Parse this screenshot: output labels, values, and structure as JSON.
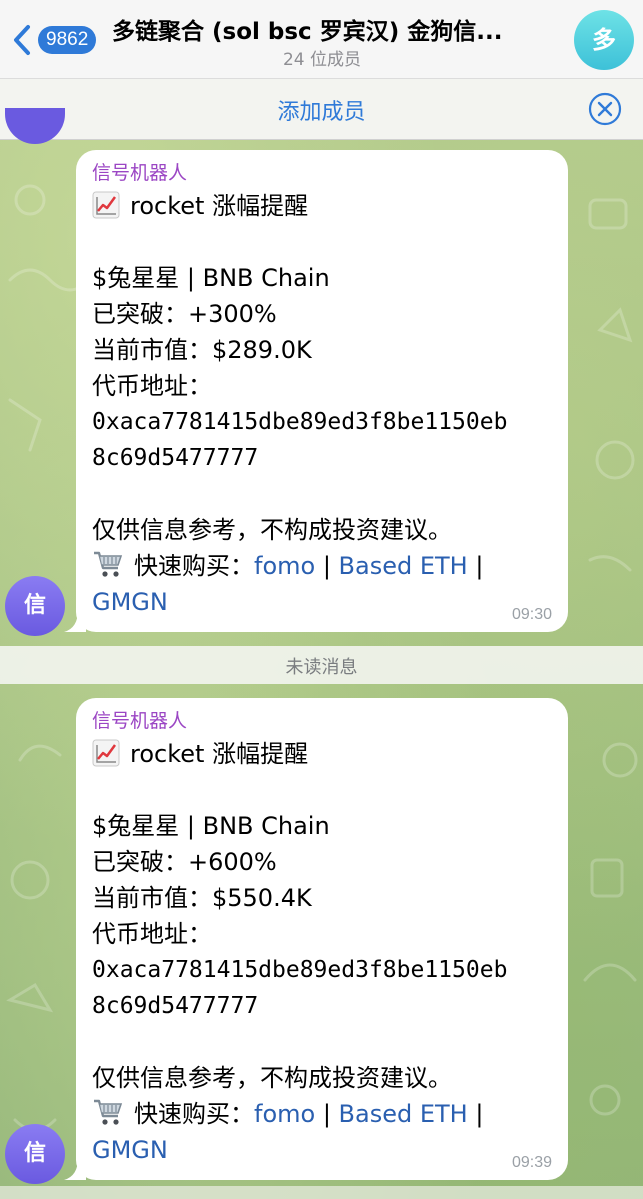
{
  "header": {
    "back_badge": "9862",
    "title": "多链聚合 (sol bsc 罗宾汉) 金狗信...",
    "subtitle": "24 位成员",
    "avatar_letter": "多"
  },
  "add_members_bar": {
    "label": "添加成员"
  },
  "unread_divider": "未读消息",
  "messages": [
    {
      "avatar_letter": "信",
      "sender": "信号机器人",
      "headline": "rocket 涨幅提醒",
      "token_line": "$兔星星 | BNB Chain",
      "breakout": "已突破：+300%",
      "market_cap": "当前市值：$289.0K",
      "address_label": "代币地址：",
      "address_line1": "0xaca7781415dbe89ed3f8be1150eb",
      "address_line2": "8c69d5477777",
      "disclaimer": "仅供信息参考，不构成投资建议。",
      "quick_buy_label": "快速购买：",
      "link_fomo": "fomo",
      "sep1": " | ",
      "link_based": "Based ETH",
      "sep2": " |",
      "link_gmgn": "GMGN",
      "time": "09:30"
    },
    {
      "avatar_letter": "信",
      "sender": "信号机器人",
      "headline": "rocket 涨幅提醒",
      "token_line": "$兔星星 | BNB Chain",
      "breakout": "已突破：+600%",
      "market_cap": "当前市值：$550.4K",
      "address_label": "代币地址：",
      "address_line1": "0xaca7781415dbe89ed3f8be1150eb",
      "address_line2": "8c69d5477777",
      "disclaimer": "仅供信息参考，不构成投资建议。",
      "quick_buy_label": "快速购买：",
      "link_fomo": "fomo",
      "sep1": " | ",
      "link_based": "Based ETH",
      "sep2": " |",
      "link_gmgn": "GMGN",
      "time": "09:39"
    }
  ],
  "icons": {
    "back": "chevron-left-icon",
    "close": "close-circle-icon",
    "chart": "chart-increasing-icon",
    "cart": "shopping-cart-icon"
  },
  "colors": {
    "accent": "#2f7ad8",
    "sender": "#9b46c4",
    "link": "#2a5fb0",
    "avatar_bot": "#6a5ae0",
    "avatar_group": "#3dc1d8"
  }
}
